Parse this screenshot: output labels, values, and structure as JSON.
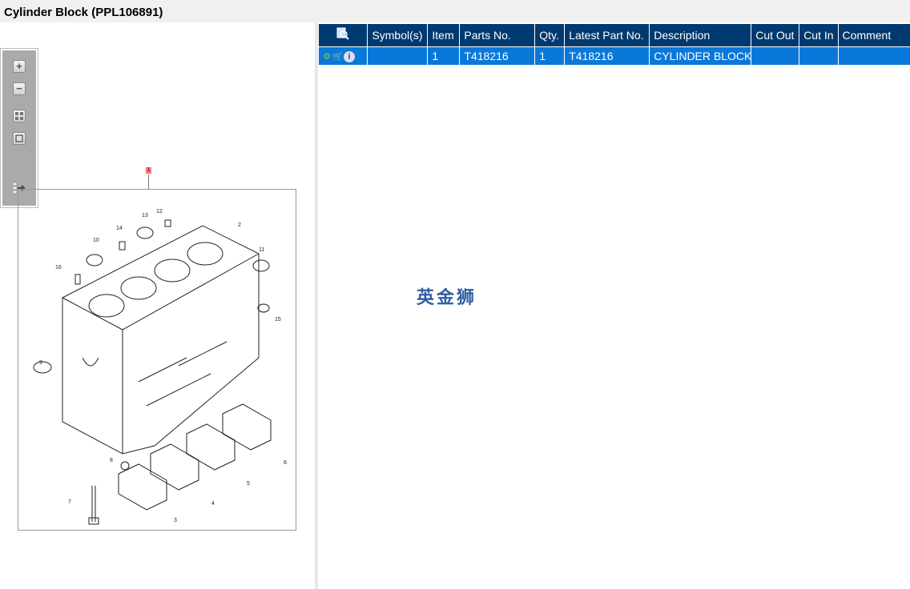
{
  "title": "Cylinder Block (PPL106891)",
  "toolbar": {
    "zoom_in": "+",
    "zoom_out": "−"
  },
  "diagram": {
    "marker": "1",
    "callouts": [
      "2",
      "3",
      "4",
      "5",
      "6",
      "7",
      "8",
      "9",
      "10",
      "11",
      "12",
      "13",
      "14",
      "15",
      "16"
    ]
  },
  "table": {
    "headers": [
      "Symbol(s)",
      "Item",
      "Parts No.",
      "Qty.",
      "Latest Part No.",
      "Description",
      "Cut Out",
      "Cut In",
      "Comment"
    ],
    "rows": [
      {
        "symbols": "",
        "item": "1",
        "parts_no": "T418216",
        "qty": "1",
        "latest_part_no": "T418216",
        "description": "CYLINDER BLOCK A",
        "cut_out": "",
        "cut_in": "",
        "comment": ""
      }
    ]
  },
  "watermark": "英金狮",
  "colors": {
    "header": "#003a70",
    "row_selected": "#0a78d8"
  }
}
